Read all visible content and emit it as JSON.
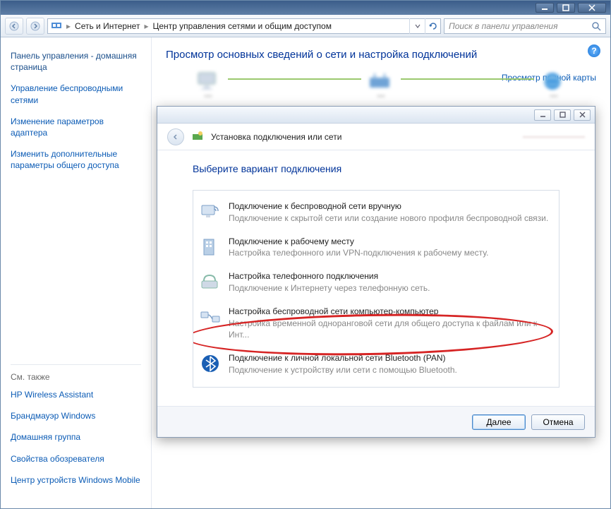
{
  "titlebar": {
    "text": ""
  },
  "breadcrumb": {
    "item1": "Сеть и Интернет",
    "item2": "Центр управления сетями и общим доступом"
  },
  "search": {
    "placeholder": "Поиск в панели управления"
  },
  "sidebar": {
    "home": "Панель управления - домашняя страница",
    "links": [
      "Управление беспроводными сетями",
      "Изменение параметров адаптера",
      "Изменить дополнительные параметры общего доступа"
    ],
    "seealso_label": "См. также",
    "seealso": [
      "HP Wireless Assistant",
      "Брандмауэр Windows",
      "Домашняя группа",
      "Свойства обозревателя",
      "Центр устройств Windows Mobile"
    ]
  },
  "main": {
    "heading": "Просмотр основных сведений о сети и настройка подключений",
    "view_full_map": "Просмотр полной карты"
  },
  "dialog": {
    "header": "Установка подключения или сети",
    "subheading": "Выберите вариант подключения",
    "options": [
      {
        "title": "Подключение к беспроводной сети вручную",
        "desc": "Подключение к скрытой сети или создание нового профиля беспроводной связи."
      },
      {
        "title": "Подключение к рабочему месту",
        "desc": "Настройка телефонного или VPN-подключения к рабочему месту."
      },
      {
        "title": "Настройка телефонного подключения",
        "desc": "Подключение к Интернету через телефонную сеть."
      },
      {
        "title": "Настройка беспроводной сети компьютер-компьютер",
        "desc": "Настройка временной одноранговой сети для общего доступа к файлам или к Инт..."
      },
      {
        "title": "Подключение к личной локальной сети Bluetooth (PAN)",
        "desc": "Подключение к устройству или сети с помощью Bluetooth."
      }
    ],
    "next": "Далее",
    "cancel": "Отмена"
  }
}
